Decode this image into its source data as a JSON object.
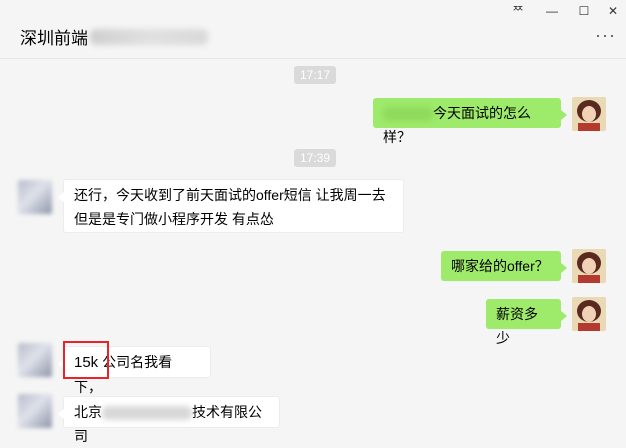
{
  "window": {
    "pin_glyph": "ᄍ",
    "minimize_glyph": "—",
    "maximize_glyph": "☐",
    "close_glyph": "✕"
  },
  "header": {
    "title": "深圳前端",
    "more_glyph": "···"
  },
  "colors": {
    "accent_bubble": "#9eea6a",
    "highlight": "#e8232a"
  },
  "timestamps": [
    "17:17",
    "17:39"
  ],
  "messages": [
    {
      "side": "right",
      "text": "今天面试的怎么样？"
    },
    {
      "side": "left",
      "text_line1": "还行，今天收到了前天面试的offer短信 让我周一去",
      "text_line2": "但是是专门做小程序开发 有点怂"
    },
    {
      "side": "right",
      "text": "哪家给的offer？"
    },
    {
      "side": "right",
      "text": "薪资多少"
    },
    {
      "side": "left",
      "text_part1": "15k",
      "text_part2": " 公司名我看下，"
    },
    {
      "side": "left",
      "text_prefix": "北京",
      "text_suffix": "技术有限公司"
    }
  ]
}
